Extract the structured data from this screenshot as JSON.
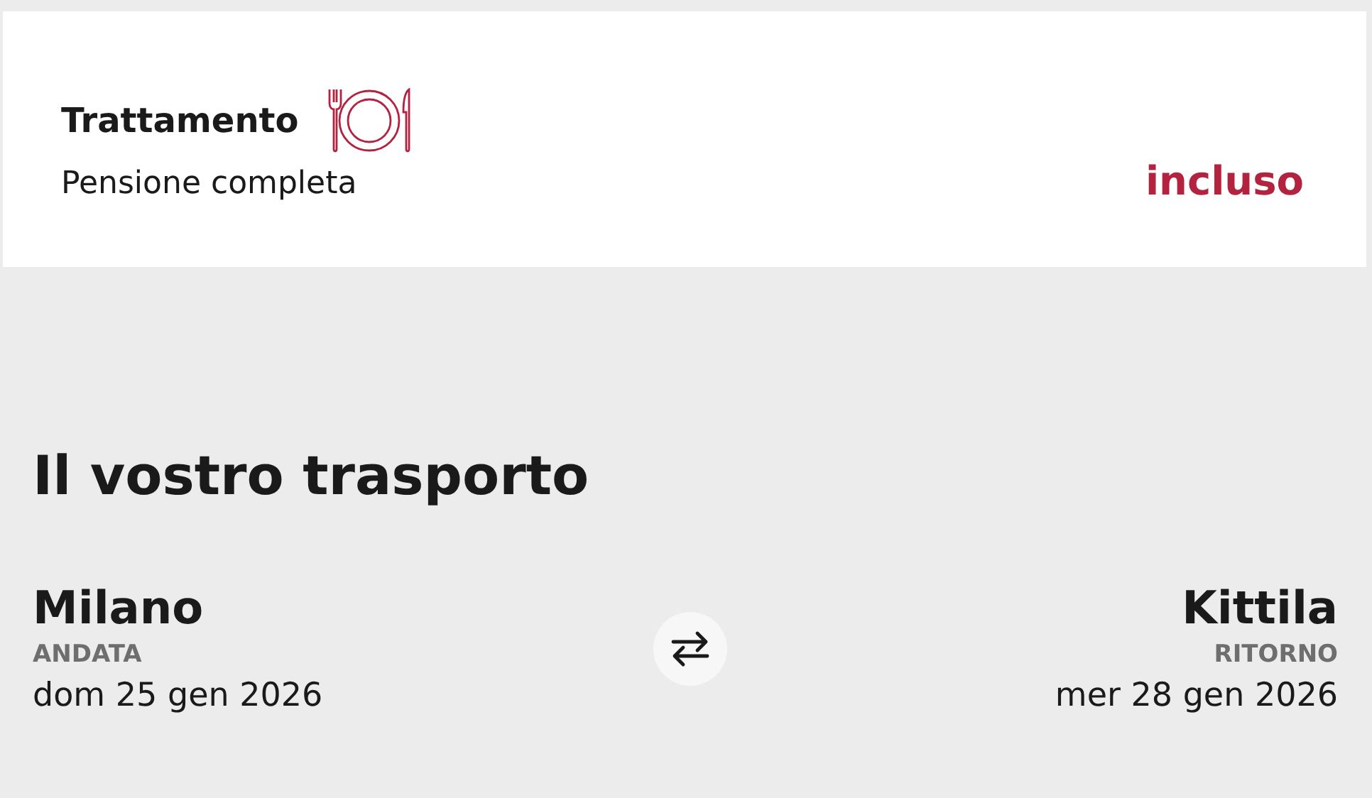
{
  "meal_card": {
    "title": "Trattamento",
    "board": "Pensione completa",
    "price_status": "incluso"
  },
  "transport": {
    "title": "Il vostro trasporto",
    "outbound": {
      "city": "Milano",
      "label": "ANDATA",
      "date": "dom 25 gen 2026"
    },
    "return": {
      "city": "Kittila",
      "label": "RITORNO",
      "date": "mer 28 gen 2026"
    }
  }
}
